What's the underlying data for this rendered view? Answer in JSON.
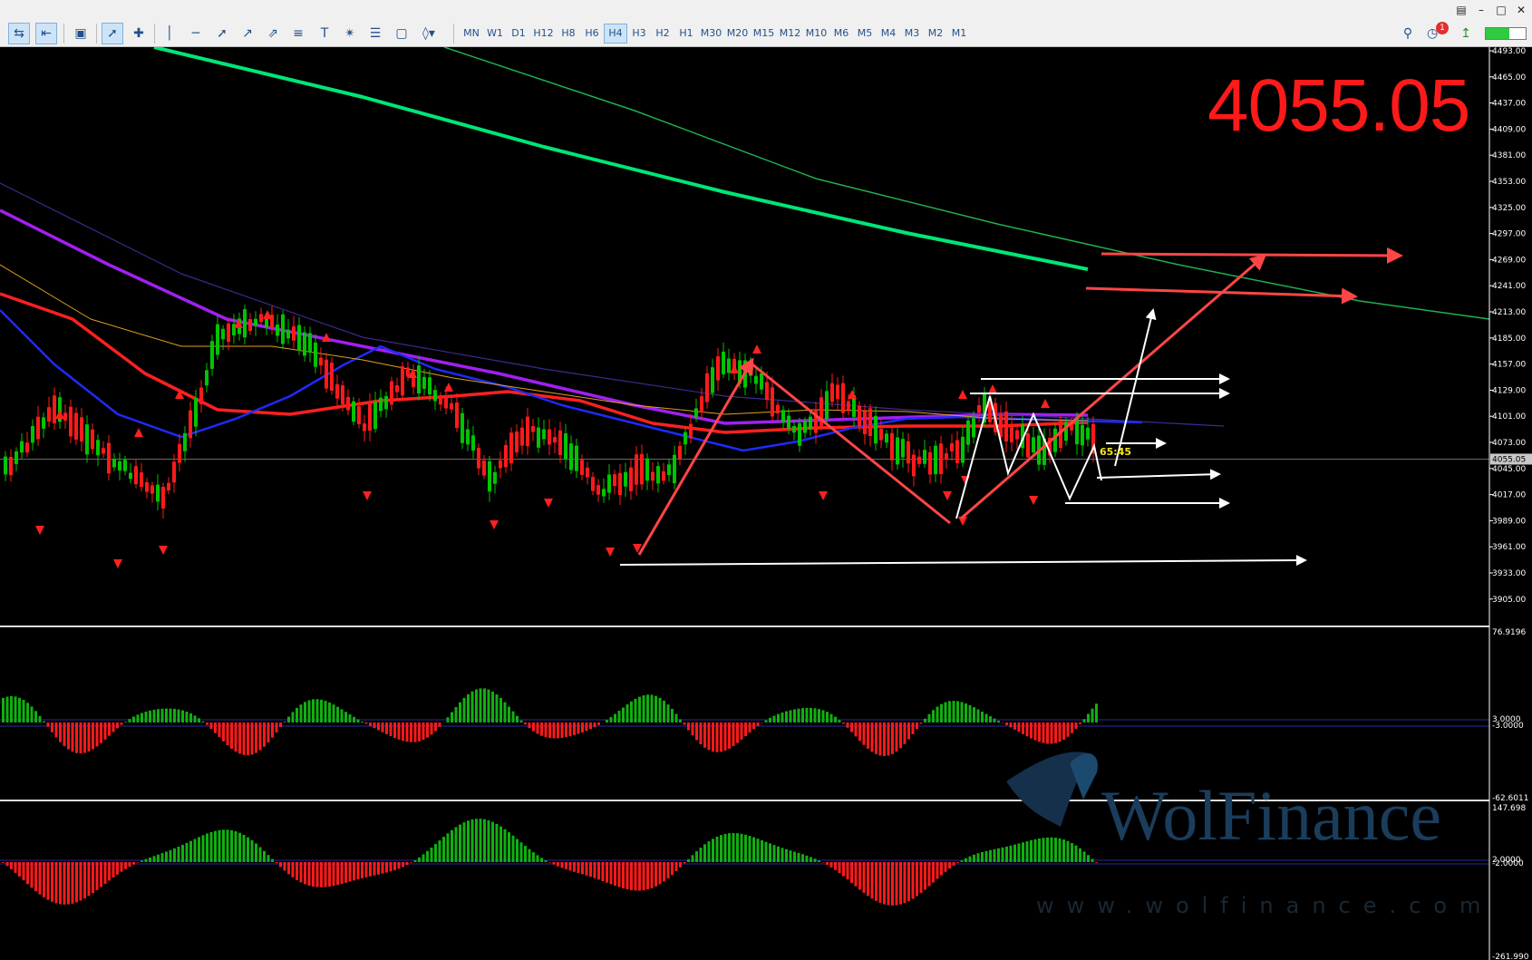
{
  "toolbar": {
    "timeframes": [
      "MN",
      "W1",
      "D1",
      "H12",
      "H8",
      "H6",
      "H4",
      "H3",
      "H2",
      "H1",
      "M30",
      "M20",
      "M15",
      "M12",
      "M10",
      "M6",
      "M5",
      "M4",
      "M3",
      "M2",
      "M1"
    ],
    "active_timeframe": "H4",
    "alert_count": "1",
    "battery_level": 0.6
  },
  "chart": {
    "current_price": "4055.05",
    "price_tag": "4055.05",
    "countdown": "65:45",
    "price_axis": [
      "4493.00",
      "4465.00",
      "4437.00",
      "4409.00",
      "4381.00",
      "4353.00",
      "4325.00",
      "4297.00",
      "4269.00",
      "4241.00",
      "4213.00",
      "4185.00",
      "4157.00",
      "4129.00",
      "4101.00",
      "4073.00",
      "4045.00",
      "4017.00",
      "3989.00",
      "3961.00",
      "3933.00",
      "3905.00"
    ],
    "osc1_axis": [
      "76.9196",
      "3.0000",
      "-3.0000",
      "-62.6011"
    ],
    "osc2_axis": [
      "147.698",
      "2.0000",
      "-2.0000",
      "-261.990"
    ]
  },
  "watermark": {
    "brand": "WolFinance",
    "url": "www.wolfinance.com"
  },
  "colors": {
    "price_text": "#ff1a1a",
    "bull_candle": "#00c400",
    "bear_candle": "#ff1a1a",
    "ma_green": "#00e676",
    "ma_purple": "#a020f0",
    "ma_red": "#ff2020",
    "ma_blue": "#1e2bff"
  }
}
